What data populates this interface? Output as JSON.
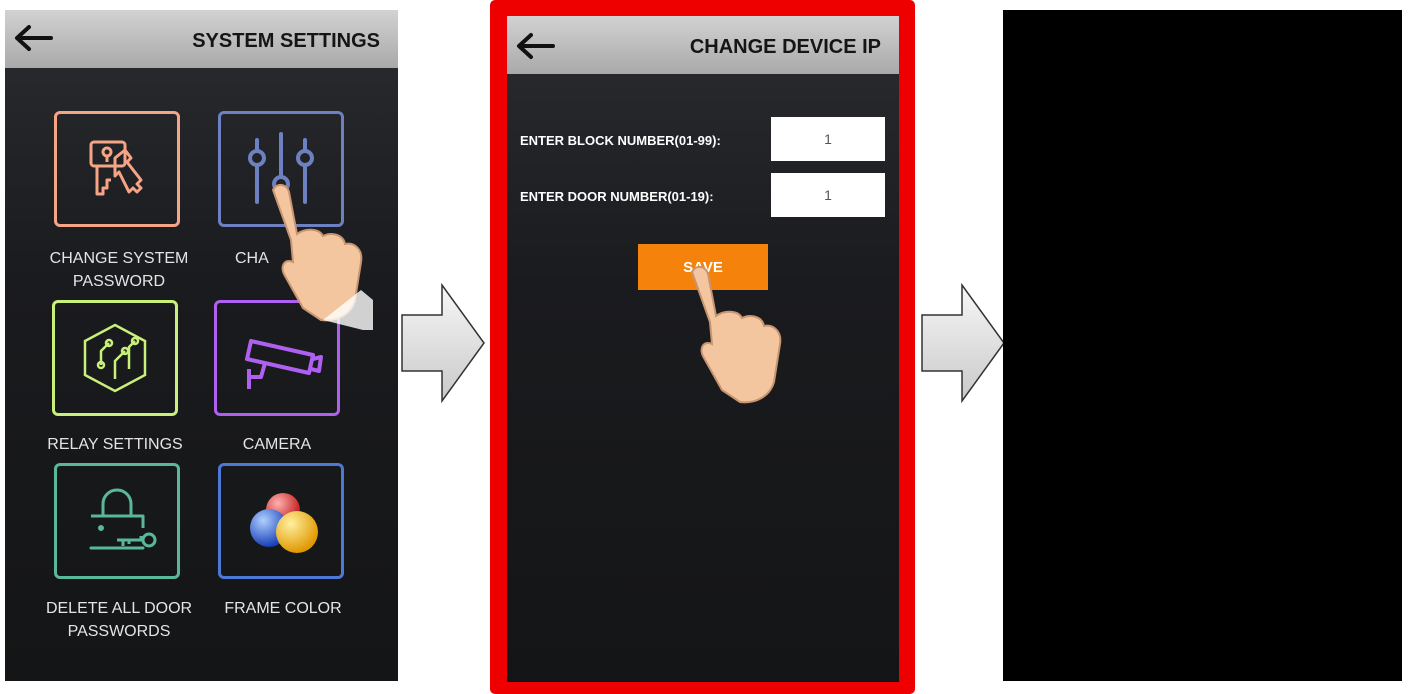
{
  "screen1": {
    "title": "SYSTEM SETTINGS",
    "tiles": [
      {
        "label": "CHANGE SYSTEM\nPASSWORD",
        "icon": "keys-icon",
        "color": "#f5a585"
      },
      {
        "label": "CHA",
        "icon": "sliders-icon",
        "color": "#6d80c2"
      },
      {
        "label": "RELAY SETTINGS",
        "icon": "circuit-hex-icon",
        "color": "#c8f07a"
      },
      {
        "label": "CAMERA",
        "icon": "camera-icon",
        "color": "#b060f0"
      },
      {
        "label": "DELETE ALL DOOR\nPASSWORDS",
        "icon": "padlock-key-icon",
        "color": "#5ab89a"
      },
      {
        "label": "FRAME COLOR",
        "icon": "color-balls-icon",
        "color": "#4c78d8"
      }
    ]
  },
  "screen2": {
    "title": "CHANGE DEVICE IP",
    "block_label": "ENTER BLOCK NUMBER(01-99):",
    "block_value": "1",
    "door_label": "ENTER DOOR NUMBER(01-19):",
    "door_value": "1",
    "save_label": "SAVE",
    "highlight_color": "#ee0000",
    "accent_color": "#f5830b"
  },
  "icons": {
    "back": "back-arrow-icon",
    "flow": "flow-arrow-icon",
    "pointer": "pointing-hand-icon"
  }
}
